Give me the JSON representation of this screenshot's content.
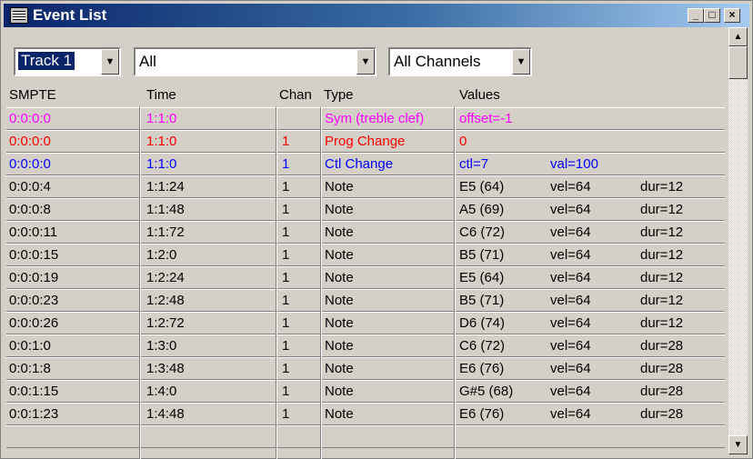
{
  "window": {
    "title": "Event List"
  },
  "toolbar": {
    "track": "Track 1",
    "filter": "All",
    "channels": "All Channels"
  },
  "columns": [
    "SMPTE",
    "Time",
    "Chan",
    "Type",
    "Values"
  ],
  "colors": {
    "magenta": "#ff00ff",
    "red": "#ff0000",
    "blue": "#0000ff",
    "black": "#000000"
  },
  "events": [
    {
      "smpte": "0:0:0:0",
      "time": "1:1:0",
      "chan": "",
      "type": "Sym (treble clef)",
      "v1": "offset=-1",
      "v2": "",
      "v3": "",
      "color": "#ff00ff"
    },
    {
      "smpte": "0:0:0:0",
      "time": "1:1:0",
      "chan": "1",
      "type": "Prog Change",
      "v1": "0",
      "v2": "",
      "v3": "",
      "color": "#ff0000"
    },
    {
      "smpte": "0:0:0:0",
      "time": "1:1:0",
      "chan": "1",
      "type": "Ctl Change",
      "v1": "ctl=7",
      "v2": "val=100",
      "v3": "",
      "color": "#0000ff"
    },
    {
      "smpte": "0:0:0:4",
      "time": "1:1:24",
      "chan": "1",
      "type": "Note",
      "v1": "E5 (64)",
      "v2": "vel=64",
      "v3": "dur=12",
      "color": "#000000"
    },
    {
      "smpte": "0:0:0:8",
      "time": "1:1:48",
      "chan": "1",
      "type": "Note",
      "v1": "A5 (69)",
      "v2": "vel=64",
      "v3": "dur=12",
      "color": "#000000"
    },
    {
      "smpte": "0:0:0:11",
      "time": "1:1:72",
      "chan": "1",
      "type": "Note",
      "v1": "C6 (72)",
      "v2": "vel=64",
      "v3": "dur=12",
      "color": "#000000"
    },
    {
      "smpte": "0:0:0:15",
      "time": "1:2:0",
      "chan": "1",
      "type": "Note",
      "v1": "B5 (71)",
      "v2": "vel=64",
      "v3": "dur=12",
      "color": "#000000"
    },
    {
      "smpte": "0:0:0:19",
      "time": "1:2:24",
      "chan": "1",
      "type": "Note",
      "v1": "E5 (64)",
      "v2": "vel=64",
      "v3": "dur=12",
      "color": "#000000"
    },
    {
      "smpte": "0:0:0:23",
      "time": "1:2:48",
      "chan": "1",
      "type": "Note",
      "v1": "B5 (71)",
      "v2": "vel=64",
      "v3": "dur=12",
      "color": "#000000"
    },
    {
      "smpte": "0:0:0:26",
      "time": "1:2:72",
      "chan": "1",
      "type": "Note",
      "v1": "D6 (74)",
      "v2": "vel=64",
      "v3": "dur=12",
      "color": "#000000"
    },
    {
      "smpte": "0:0:1:0",
      "time": "1:3:0",
      "chan": "1",
      "type": "Note",
      "v1": "C6 (72)",
      "v2": "vel=64",
      "v3": "dur=28",
      "color": "#000000"
    },
    {
      "smpte": "0:0:1:8",
      "time": "1:3:48",
      "chan": "1",
      "type": "Note",
      "v1": "E6 (76)",
      "v2": "vel=64",
      "v3": "dur=28",
      "color": "#000000"
    },
    {
      "smpte": "0:0:1:15",
      "time": "1:4:0",
      "chan": "1",
      "type": "Note",
      "v1": "G#5 (68)",
      "v2": "vel=64",
      "v3": "dur=28",
      "color": "#000000"
    },
    {
      "smpte": "0:0:1:23",
      "time": "1:4:48",
      "chan": "1",
      "type": "Note",
      "v1": "E6 (76)",
      "v2": "vel=64",
      "v3": "dur=28",
      "color": "#000000"
    }
  ]
}
